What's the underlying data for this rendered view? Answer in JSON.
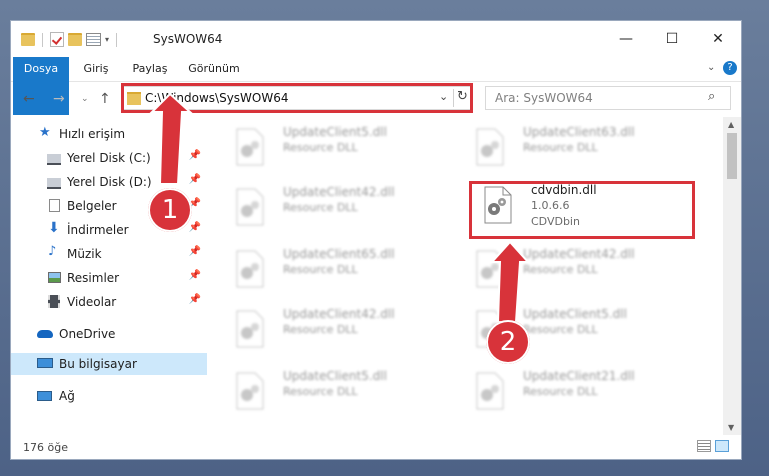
{
  "window": {
    "title": "SysWOW64",
    "minimize_glyph": "—",
    "maximize_glyph": "☐",
    "close_glyph": "✕"
  },
  "ribbon": {
    "tabs": [
      {
        "label": "Dosya"
      },
      {
        "label": "Giriş"
      },
      {
        "label": "Paylaş"
      },
      {
        "label": "Görünüm"
      }
    ],
    "help_icon": "help-icon",
    "expand_icon": "chevron-down-icon"
  },
  "address": {
    "path": "C:\\Windows\\SysWOW64",
    "search_placeholder": "Ara: SysWOW64"
  },
  "sidebar": {
    "items": [
      {
        "label": "Hızlı erişim",
        "icon": "star-icon"
      },
      {
        "label": "Yerel Disk (C:)",
        "icon": "drive-icon",
        "pinned": true
      },
      {
        "label": "Yerel Disk (D:)",
        "icon": "drive-icon",
        "pinned": true
      },
      {
        "label": "Belgeler",
        "icon": "document-icon",
        "pinned": true
      },
      {
        "label": "İndirmeler",
        "icon": "download-icon",
        "pinned": true
      },
      {
        "label": "Müzik",
        "icon": "music-icon",
        "pinned": true
      },
      {
        "label": "Resimler",
        "icon": "pictures-icon",
        "pinned": true
      },
      {
        "label": "Videolar",
        "icon": "video-icon",
        "pinned": true
      },
      {
        "label": "OneDrive",
        "icon": "cloud-icon"
      },
      {
        "label": "Bu bilgisayar",
        "icon": "computer-icon",
        "selected": true
      },
      {
        "label": "Ağ",
        "icon": "network-icon"
      }
    ]
  },
  "files": [
    {
      "name": "UpdateClient5.dll",
      "type": "Resource DLL"
    },
    {
      "name": "UpdateClient63.dll",
      "type": "Resource DLL"
    },
    {
      "name": "UpdateClient42.dll",
      "type": "Resource DLL"
    },
    {
      "name": "cdvdbin.dll",
      "version": "1.0.6.6",
      "type": "CDVDbin",
      "highlighted": true
    },
    {
      "name": "UpdateClient65.dll",
      "type": "Resource DLL"
    },
    {
      "name": "UpdateClient42.dll",
      "type": "Resource DLL"
    },
    {
      "name": "UpdateClient42.dll",
      "type": "Resource DLL"
    },
    {
      "name": "UpdateClient5.dll",
      "type": "Resource DLL"
    },
    {
      "name": "UpdateClient5.dll",
      "type": "Resource DLL"
    },
    {
      "name": "UpdateClient21.dll",
      "type": "Resource DLL"
    }
  ],
  "status": {
    "count": "176 öğe"
  },
  "annotations": {
    "badge1": "1",
    "badge2": "2",
    "color": "#d8333a"
  }
}
